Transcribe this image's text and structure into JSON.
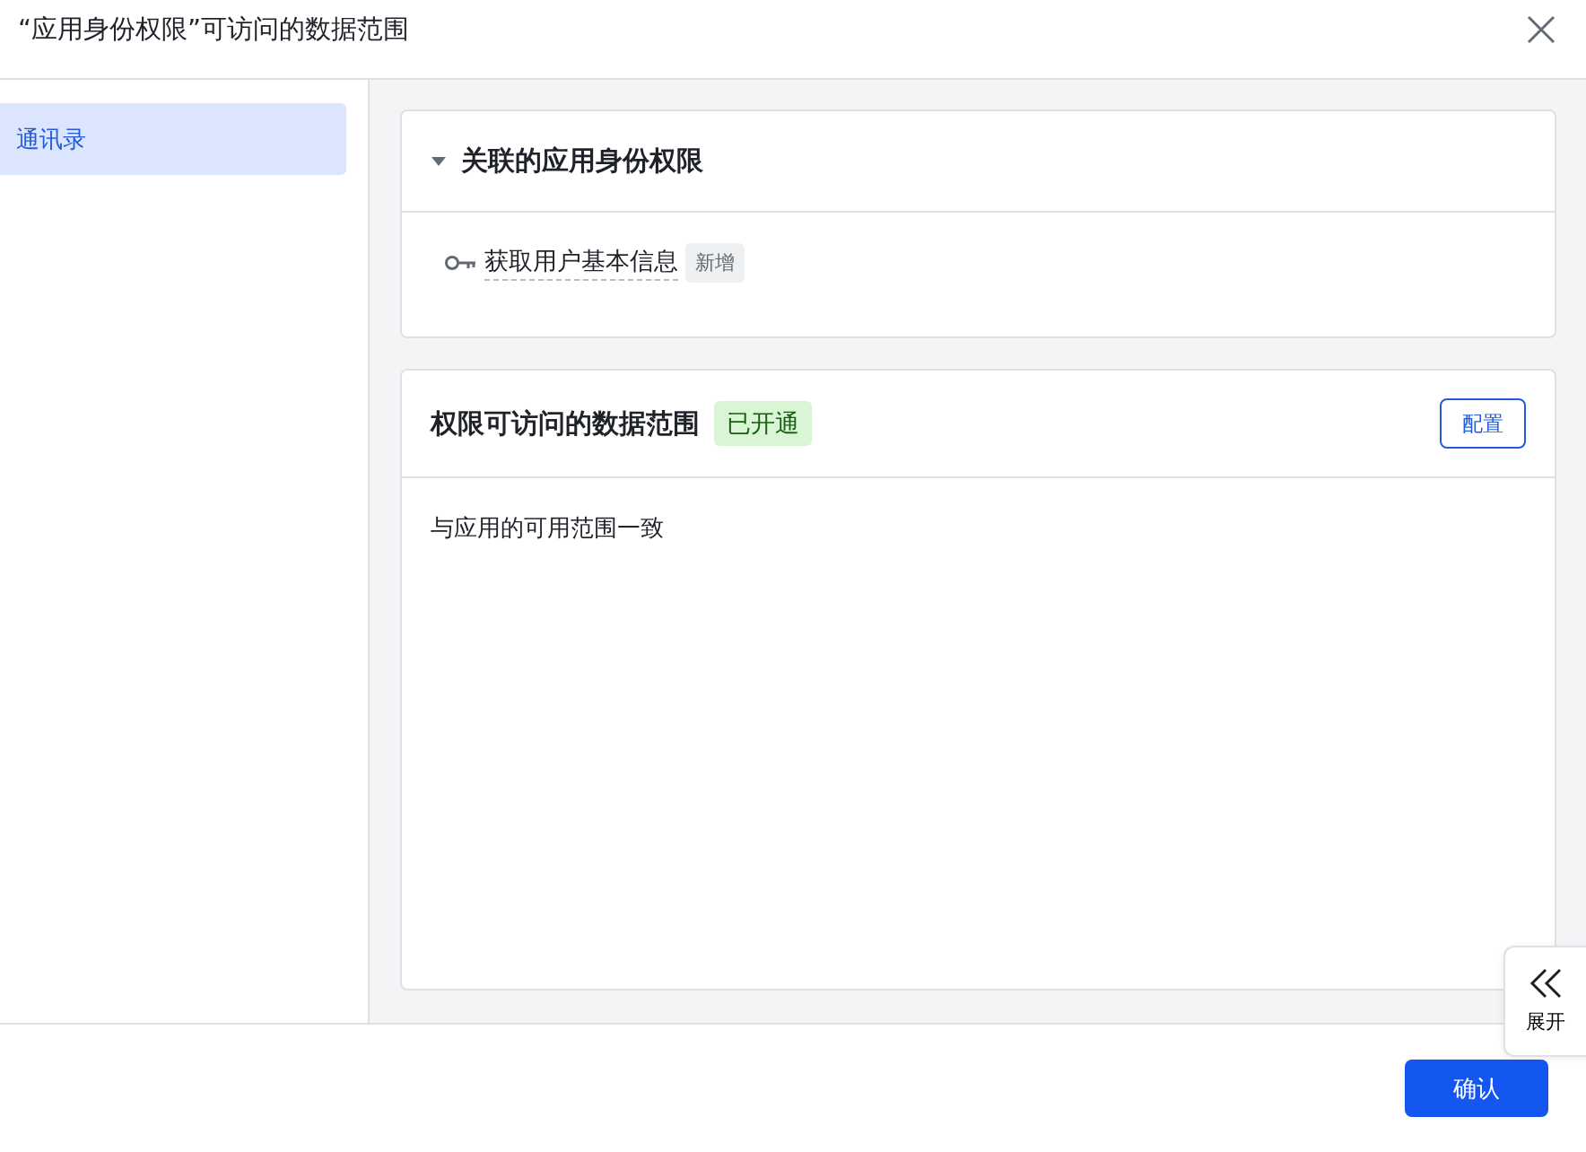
{
  "dialog": {
    "title": "“应用身份权限”可访问的数据范围"
  },
  "sidebar": {
    "items": [
      {
        "label": "通讯录",
        "selected": true
      }
    ]
  },
  "linked_section": {
    "title": "关联的应用身份权限",
    "expanded": true,
    "items": [
      {
        "label": "获取用户基本信息",
        "badge": "新增"
      }
    ]
  },
  "scope_section": {
    "title": "权限可访问的数据范围",
    "status": "已开通",
    "config_button": "配置",
    "description": "与应用的可用范围一致"
  },
  "expand_button": {
    "label": "展开"
  },
  "footer": {
    "confirm_button": "确认"
  }
}
